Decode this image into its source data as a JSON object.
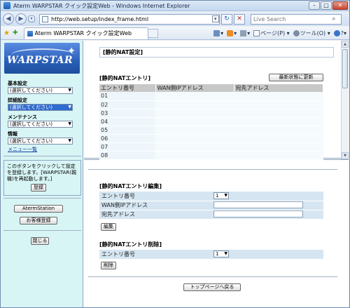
{
  "window": {
    "title": "Aterm WARPSTAR クイック設定Web - Windows Internet Explorer",
    "buttons": {
      "minimize": "–",
      "maximize": "□",
      "close": "✕"
    }
  },
  "addressbar": {
    "url": "http://web.setup/index_frame.html",
    "search_placeholder": "Live Search"
  },
  "tab": {
    "title": "Aterm WARPSTAR クイック設定Web"
  },
  "commands": {
    "home": "▾",
    "feeds": "▾",
    "print": "▾",
    "page": "ページ(P) ▾",
    "tools": "ツール(O) ▾",
    "help": "?▾"
  },
  "sidebar": {
    "logo": "WARPSTAR",
    "menus": [
      {
        "label": "基本設定",
        "value": "(選択してください)",
        "selected": false
      },
      {
        "label": "詳細設定",
        "value": "(選択してください)",
        "selected": true
      },
      {
        "label": "メンテナンス",
        "value": "(選択してください)",
        "selected": false
      },
      {
        "label": "情報",
        "value": "(選択してください)",
        "selected": false
      }
    ],
    "menu_list_link": "メニュー一覧",
    "note_text": "このボタンをクリックして設定を登録します。[WARPSTAR(親機)を再起動します。]",
    "register_button": "登録",
    "aterm_station_button": "AtermStation",
    "customer_register_button": "お客様登録",
    "close_button": "閉じる"
  },
  "top_frame": {
    "page_title": "[静的NAT設定]",
    "entry_section_title": "[静的NATエントリ]",
    "refresh_button": "最新状態に更新",
    "columns": [
      "エントリ番号",
      "WAN側IPアドレス",
      "宛先アドレス"
    ],
    "rows": [
      "01",
      "02",
      "03",
      "04",
      "05",
      "06",
      "07",
      "08"
    ]
  },
  "bottom_frame": {
    "edit_title": "[静的NATエントリ編集]",
    "edit_entry_label": "エントリ番号",
    "edit_entry_value": "1",
    "wan_ip_label": "WAN側IPアドレス",
    "dest_label": "宛先アドレス",
    "edit_button": "編集",
    "delete_title": "[静的NATエントリ削除]",
    "delete_entry_label": "エントリ番号",
    "delete_entry_value": "1",
    "delete_button": "削除",
    "top_page_button": "トップページへ戻る"
  }
}
